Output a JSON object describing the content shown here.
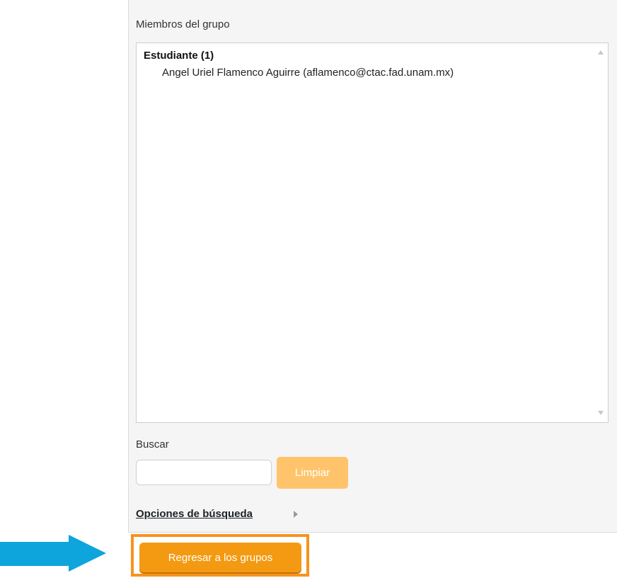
{
  "group_members": {
    "label": "Miembros del grupo",
    "role_heading": "Estudiante (1)",
    "members": [
      "Angel Uriel Flamenco Aguirre (aflamenco@ctac.fad.unam.mx)"
    ]
  },
  "search": {
    "label": "Buscar",
    "value": "",
    "clear_label": "Limpiar",
    "options_label": "Opciones de búsqueda"
  },
  "actions": {
    "back_label": "Regresar a los grupos"
  },
  "colors": {
    "accent": "#f39a12",
    "accent_disabled": "#ffc46b",
    "highlight": "#f7931e",
    "pointer_arrow": "#0ea5dd"
  },
  "icons": {
    "pointer": "right-arrow-icon",
    "expand": "triangle-right-icon"
  }
}
